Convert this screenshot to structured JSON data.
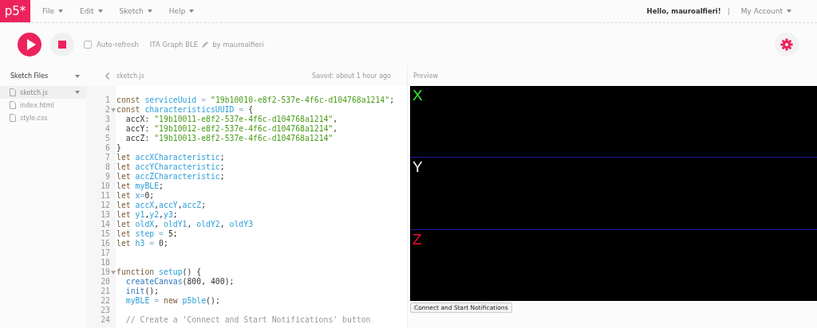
{
  "nav": {
    "logo": "p5*",
    "menus": [
      {
        "label": "File"
      },
      {
        "label": "Edit"
      },
      {
        "label": "Sketch"
      },
      {
        "label": "Help"
      }
    ],
    "greeting": "Hello, mauroalfieri!",
    "separator": "|",
    "account": "My Account"
  },
  "toolbar": {
    "auto_refresh": {
      "label": "Auto-refresh",
      "checked": false
    },
    "sketch_name": "ITA Graph BLE",
    "owner": "by mauroalfieri"
  },
  "sidebar": {
    "title": "Sketch Files",
    "files": [
      {
        "name": "sketch.js",
        "selected": true
      },
      {
        "name": "index.html",
        "selected": false
      },
      {
        "name": "style.css",
        "selected": false
      }
    ]
  },
  "editor": {
    "tab": "sketch.js",
    "status": "Saved: about 1 hour ago",
    "lines": [
      {
        "number": "1",
        "foldable": false,
        "tokens": [
          {
            "kind": "keyword",
            "text": "const "
          },
          {
            "kind": "name",
            "text": "serviceUuid"
          },
          {
            "kind": "operator",
            "text": " = "
          },
          {
            "kind": "string",
            "text": "\"19b10010-e8f2-537e-4f6c-d104768a1214\""
          },
          {
            "kind": "plain",
            "text": ";"
          }
        ]
      },
      {
        "number": "2",
        "foldable": true,
        "tokens": [
          {
            "kind": "keyword",
            "text": "const "
          },
          {
            "kind": "name",
            "text": "characteristicsUUID"
          },
          {
            "kind": "operator",
            "text": " = "
          },
          {
            "kind": "plain",
            "text": "{"
          }
        ]
      },
      {
        "number": "3",
        "foldable": false,
        "tokens": [
          {
            "kind": "plain",
            "text": "  accX: "
          },
          {
            "kind": "string",
            "text": "\"19b10011-e8f2-537e-4f6c-d104768a1214\""
          },
          {
            "kind": "plain",
            "text": ","
          }
        ]
      },
      {
        "number": "4",
        "foldable": false,
        "tokens": [
          {
            "kind": "plain",
            "text": "  accY: "
          },
          {
            "kind": "string",
            "text": "\"19b10012-e8f2-537e-4f6c-d104768a1214\""
          },
          {
            "kind": "plain",
            "text": ","
          }
        ]
      },
      {
        "number": "5",
        "foldable": false,
        "tokens": [
          {
            "kind": "plain",
            "text": "  accZ: "
          },
          {
            "kind": "string",
            "text": "\"19b10013-e8f2-537e-4f6c-d104768a1214\""
          }
        ]
      },
      {
        "number": "6",
        "foldable": false,
        "tokens": [
          {
            "kind": "plain",
            "text": "}"
          }
        ]
      },
      {
        "number": "7",
        "foldable": false,
        "tokens": [
          {
            "kind": "keyword",
            "text": "let "
          },
          {
            "kind": "name",
            "text": "accXCharacteristic"
          },
          {
            "kind": "plain",
            "text": ";"
          }
        ]
      },
      {
        "number": "8",
        "foldable": false,
        "tokens": [
          {
            "kind": "keyword",
            "text": "let "
          },
          {
            "kind": "name",
            "text": "accYCharacteristic"
          },
          {
            "kind": "plain",
            "text": ";"
          }
        ]
      },
      {
        "number": "9",
        "foldable": false,
        "tokens": [
          {
            "kind": "keyword",
            "text": "let "
          },
          {
            "kind": "name",
            "text": "accZCharacteristic"
          },
          {
            "kind": "plain",
            "text": ";"
          }
        ]
      },
      {
        "number": "10",
        "foldable": false,
        "tokens": [
          {
            "kind": "keyword",
            "text": "let "
          },
          {
            "kind": "name",
            "text": "myBLE"
          },
          {
            "kind": "plain",
            "text": ";"
          }
        ]
      },
      {
        "number": "11",
        "foldable": false,
        "tokens": [
          {
            "kind": "keyword",
            "text": "let "
          },
          {
            "kind": "name",
            "text": "x"
          },
          {
            "kind": "operator",
            "text": "="
          },
          {
            "kind": "plain",
            "text": "0;"
          }
        ]
      },
      {
        "number": "12",
        "foldable": false,
        "tokens": [
          {
            "kind": "keyword",
            "text": "let "
          },
          {
            "kind": "name",
            "text": "accX"
          },
          {
            "kind": "plain",
            "text": ","
          },
          {
            "kind": "name",
            "text": "accY"
          },
          {
            "kind": "plain",
            "text": ","
          },
          {
            "kind": "name",
            "text": "accZ"
          },
          {
            "kind": "plain",
            "text": ";"
          }
        ]
      },
      {
        "number": "13",
        "foldable": false,
        "tokens": [
          {
            "kind": "keyword",
            "text": "let "
          },
          {
            "kind": "name",
            "text": "y1"
          },
          {
            "kind": "plain",
            "text": ","
          },
          {
            "kind": "name",
            "text": "y2"
          },
          {
            "kind": "plain",
            "text": ","
          },
          {
            "kind": "name",
            "text": "y3"
          },
          {
            "kind": "plain",
            "text": ";"
          }
        ]
      },
      {
        "number": "14",
        "foldable": false,
        "tokens": [
          {
            "kind": "keyword",
            "text": "let "
          },
          {
            "kind": "name",
            "text": "oldX"
          },
          {
            "kind": "plain",
            "text": ", "
          },
          {
            "kind": "name",
            "text": "oldY1"
          },
          {
            "kind": "plain",
            "text": ", "
          },
          {
            "kind": "name",
            "text": "oldY2"
          },
          {
            "kind": "plain",
            "text": ", "
          },
          {
            "kind": "name",
            "text": "oldY3"
          }
        ]
      },
      {
        "number": "15",
        "foldable": false,
        "tokens": [
          {
            "kind": "keyword",
            "text": "let "
          },
          {
            "kind": "name",
            "text": "step"
          },
          {
            "kind": "operator",
            "text": " = "
          },
          {
            "kind": "plain",
            "text": "5;"
          }
        ]
      },
      {
        "number": "16",
        "foldable": false,
        "tokens": [
          {
            "kind": "keyword",
            "text": "let "
          },
          {
            "kind": "name",
            "text": "h3"
          },
          {
            "kind": "operator",
            "text": " = "
          },
          {
            "kind": "plain",
            "text": "0;"
          }
        ]
      },
      {
        "number": "17",
        "foldable": false
      },
      {
        "number": "18",
        "foldable": false
      },
      {
        "number": "19",
        "foldable": true,
        "tokens": [
          {
            "kind": "keyword",
            "text": "function "
          },
          {
            "kind": "name",
            "text": "setup"
          },
          {
            "kind": "plain",
            "text": "() {"
          }
        ]
      },
      {
        "number": "20",
        "foldable": false,
        "tokens": [
          {
            "kind": "call",
            "text": "  createCanvas"
          },
          {
            "kind": "plain",
            "text": "(800, 400);"
          }
        ]
      },
      {
        "number": "21",
        "foldable": false,
        "tokens": [
          {
            "kind": "call",
            "text": "  init"
          },
          {
            "kind": "plain",
            "text": "();"
          }
        ]
      },
      {
        "number": "22",
        "foldable": false,
        "tokens": [
          {
            "kind": "name",
            "text": "  myBLE"
          },
          {
            "kind": "operator",
            "text": " = "
          },
          {
            "kind": "keyword",
            "text": "new "
          },
          {
            "kind": "name",
            "text": "p5ble"
          },
          {
            "kind": "plain",
            "text": "();"
          }
        ]
      },
      {
        "number": "23",
        "foldable": false
      },
      {
        "number": "24",
        "foldable": false,
        "tokens": [
          {
            "kind": "comment",
            "text": "  // Create a 'Connect and Start Notifications' button"
          }
        ]
      }
    ]
  },
  "preview": {
    "title": "Preview",
    "panels": [
      {
        "label": "X",
        "color": "#33ee33"
      },
      {
        "label": "Y",
        "color": "#ffffff"
      },
      {
        "label": "Z",
        "color": "#ee1133"
      }
    ],
    "button": "Connect and Start Notifications"
  }
}
